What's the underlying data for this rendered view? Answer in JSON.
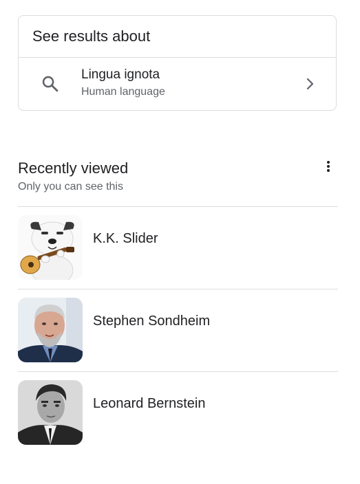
{
  "about": {
    "header": "See results about",
    "entity_title": "Lingua ignota",
    "entity_subtitle": "Human language"
  },
  "recently_viewed": {
    "title": "Recently viewed",
    "subtitle": "Only you can see this",
    "items": [
      {
        "name": "K.K. Slider",
        "thumb": "kk-slider-avatar"
      },
      {
        "name": "Stephen Sondheim",
        "thumb": "stephen-sondheim-photo"
      },
      {
        "name": "Leonard Bernstein",
        "thumb": "leonard-bernstein-photo"
      }
    ]
  },
  "colors": {
    "text_primary": "#202124",
    "text_secondary": "#5f6368",
    "divider": "#dadce0"
  },
  "icons": {
    "search": "search-icon",
    "chevron": "chevron-right-icon",
    "menu": "more-vert-icon"
  }
}
